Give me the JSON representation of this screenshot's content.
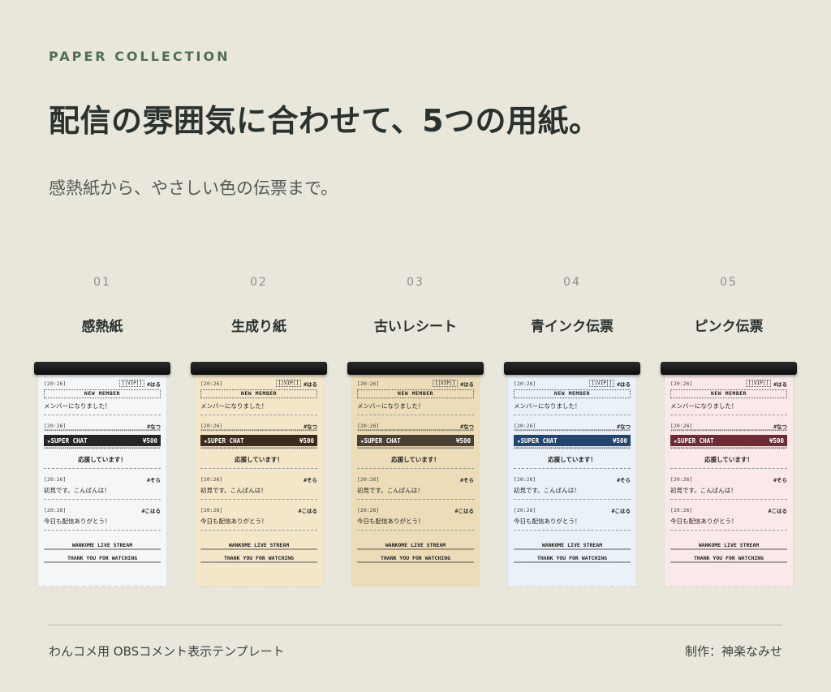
{
  "header": {
    "eyebrow": "PAPER COLLECTION",
    "headline": "配信の雰囲気に合わせて、5つの用紙。",
    "subline": "感熱紙から、やさしい色の伝票まで。"
  },
  "receipt": {
    "entries": [
      {
        "time": "[20:26]",
        "vip": "[|VIP|]",
        "user": "#はる",
        "badge": "NEW MEMBER",
        "message": "メンバーになりました！"
      },
      {
        "time": "[20:26]",
        "user": "#なつ",
        "sc_label": "★SUPER CHAT",
        "sc_amount": "¥500",
        "message": "応援しています！"
      },
      {
        "time": "[20:26]",
        "user": "#そら",
        "message": "初見です。こんばんは！"
      },
      {
        "time": "[20:26]",
        "user": "#こはる",
        "message": "今日も配信ありがとう！"
      }
    ],
    "footer_line1": "WANKOME LIVE STREAM",
    "footer_line2": "THANK YOU FOR WATCHING"
  },
  "cards": [
    {
      "num": "01",
      "title": "感熱紙",
      "paper_color": "#f5f6f7",
      "sc_color": "#262626"
    },
    {
      "num": "02",
      "title": "生成り紙",
      "paper_color": "#f3e6c9",
      "sc_color": "#3c2a1a"
    },
    {
      "num": "03",
      "title": "古いレシート",
      "paper_color": "#ecdcb8",
      "sc_color": "#4a3f33"
    },
    {
      "num": "04",
      "title": "青インク伝票",
      "paper_color": "#eaf1f8",
      "sc_color": "#22466f"
    },
    {
      "num": "05",
      "title": "ピンク伝票",
      "paper_color": "#fbe9ea",
      "sc_color": "#6e2a35"
    }
  ],
  "footer": {
    "left": "わんコメ用 OBSコメント表示テンプレート",
    "right": "制作：神楽なみせ"
  }
}
